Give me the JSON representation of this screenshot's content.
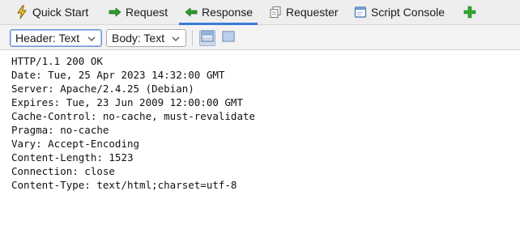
{
  "tabs": [
    {
      "label": "Quick Start",
      "icon": "lightning-icon"
    },
    {
      "label": "Request",
      "icon": "arrow-right-icon"
    },
    {
      "label": "Response",
      "icon": "arrow-left-icon",
      "active": true
    },
    {
      "label": "Requester",
      "icon": "requester-icon"
    },
    {
      "label": "Script Console",
      "icon": "console-icon"
    },
    {
      "label": "",
      "icon": "plus-icon"
    }
  ],
  "toolbar": {
    "header_select": "Header: Text",
    "body_select": "Body: Text",
    "views": [
      "split-view-icon",
      "single-view-icon"
    ]
  },
  "response": {
    "lines": [
      "HTTP/1.1 200 OK",
      "Date: Tue, 25 Apr 2023 14:32:00 GMT",
      "Server: Apache/2.4.25 (Debian)",
      "Expires: Tue, 23 Jun 2009 12:00:00 GMT",
      "Cache-Control: no-cache, must-revalidate",
      "Pragma: no-cache",
      "Vary: Accept-Encoding",
      "Content-Length: 1523",
      "Connection: close",
      "Content-Type: text/html;charset=utf-8"
    ]
  },
  "colors": {
    "accent": "#3a7bd5",
    "add_green": "#2fa82f",
    "request_green": "#2e9e2e",
    "lightning_yellow": "#f2c230"
  }
}
